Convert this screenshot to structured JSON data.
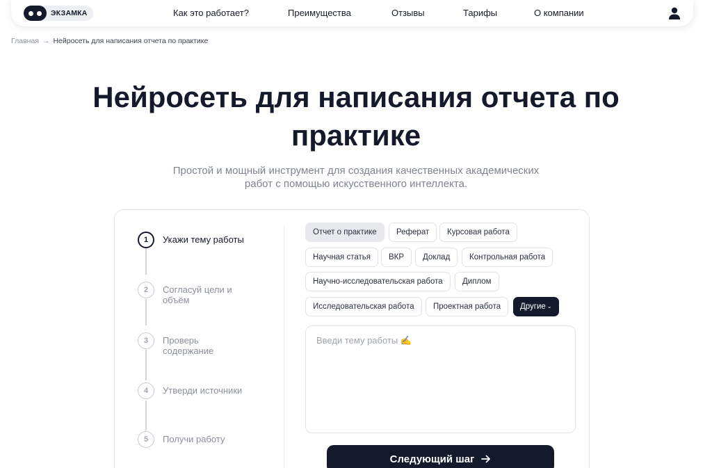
{
  "header": {
    "logo_text": "ЭКЗАМКА",
    "nav": [
      {
        "label": "Как это работает?"
      },
      {
        "label": "Преимущества"
      },
      {
        "label": "Отзывы"
      },
      {
        "label": "Тарифы"
      },
      {
        "label": "О компании"
      }
    ],
    "user_icon": "user-icon"
  },
  "breadcrumb": {
    "home": "Главная",
    "separator": "→",
    "current": "Нейросеть для написания отчета по практике"
  },
  "hero": {
    "title_line1": "Нейросеть для написания отчета по",
    "title_line2": "практике",
    "subtitle_line1": "Простой и мощный инструмент для создания качественных академических",
    "subtitle_line2": "работ с помощью искусственного интеллекта."
  },
  "steps": [
    {
      "number": "1",
      "label": "Укажи тему работы",
      "active": true
    },
    {
      "number": "2",
      "label": "Согласуй цели и объём",
      "active": false
    },
    {
      "number": "3",
      "label": "Проверь содержание",
      "active": false
    },
    {
      "number": "4",
      "label": "Утверди источники",
      "active": false
    },
    {
      "number": "5",
      "label": "Получи работу",
      "active": false
    }
  ],
  "work_types": [
    {
      "label": "Отчет о практике",
      "selected": true
    },
    {
      "label": "Реферат"
    },
    {
      "label": "Курсовая работа"
    },
    {
      "label": "Научная статья"
    },
    {
      "label": "ВКР"
    },
    {
      "label": "Доклад"
    },
    {
      "label": "Контрольная работа"
    },
    {
      "label": "Научно-исследовательская работа"
    },
    {
      "label": "Диплом"
    },
    {
      "label": "Исследовательская работа"
    },
    {
      "label": "Проектная работа"
    },
    {
      "label": "Другие",
      "dropdown": true
    }
  ],
  "topic_input": {
    "value": "",
    "placeholder": "Введи тему работы ✍️"
  },
  "next_button": {
    "label": "Следующий шаг"
  },
  "colors": {
    "primary_dark": "#141a2b",
    "muted_text": "#7e838e",
    "chip_selected_bg": "#e8e9ec",
    "border": "#e1e3e8"
  }
}
